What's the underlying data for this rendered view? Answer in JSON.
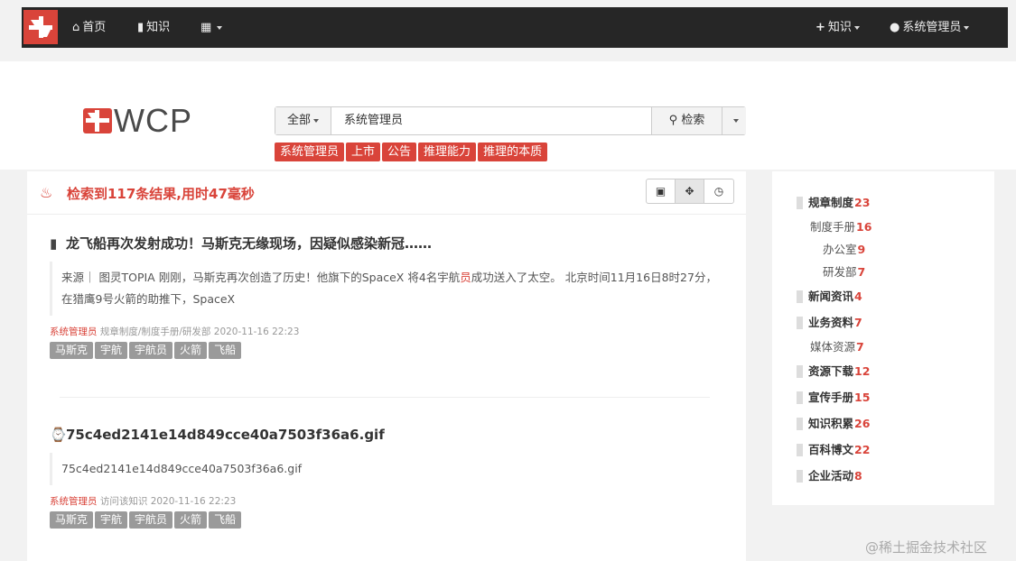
{
  "navbar": {
    "home": "首页",
    "knowledge": "知识",
    "apps": "",
    "new_knowledge": "知识",
    "user": "系统管理员",
    "colors": {
      "background": "#262626",
      "brand": "#d9443a"
    }
  },
  "brand": {
    "wordmark": "WCP"
  },
  "search": {
    "scope": "全部",
    "query": "系统管理员",
    "button": "检索"
  },
  "hot_tags": [
    "系统管理员",
    "上市",
    "公告",
    "推理能力",
    "推理的本质"
  ],
  "results": {
    "summary": "检索到117条结果,用时47毫秒",
    "view_modes": [
      "image-icon",
      "move-icon",
      "clock-icon"
    ],
    "items": [
      {
        "icon": "document-icon",
        "title": "龙飞船再次发射成功！马斯克无缘现场，因疑似感染新冠……",
        "excerpt_before": "来源｜ 图灵TOPIA 刚刚，马斯克再次创造了历史！他旗下的SpaceX 将4名宇航",
        "excerpt_highlight": "员",
        "excerpt_after": "成功送入了太空。 北京时间11月16日8时27分，在猎鹰9号火箭的助推下，SpaceX",
        "author": "系统管理员",
        "path": "规章制度/制度手册/研发部",
        "time": "2020-11-16 22:23",
        "tags": [
          "马斯克",
          "宇航",
          "宇航员",
          "火箭",
          "飞船"
        ]
      },
      {
        "icon": "paperclip-icon",
        "title": "75c4ed2141e14d849cce40a7503f36a6.gif",
        "excerpt_before": "75c4ed2141e14d849cce40a7503f36a6.gif",
        "excerpt_highlight": "",
        "excerpt_after": "",
        "author": "系统管理员",
        "path": "访问该知识",
        "time": "2020-11-16 22:23",
        "tags": [
          "马斯克",
          "宇航",
          "宇航员",
          "火箭",
          "飞船"
        ]
      }
    ]
  },
  "sidebar": {
    "categories": [
      {
        "level": 1,
        "name": "规章制度",
        "count": "23"
      },
      {
        "level": 2,
        "name": "制度手册",
        "count": "16"
      },
      {
        "level": 3,
        "name": "办公室",
        "count": "9"
      },
      {
        "level": 3,
        "name": "研发部",
        "count": "7"
      },
      {
        "level": 1,
        "name": "新闻资讯",
        "count": "4"
      },
      {
        "level": 1,
        "name": "业务资料",
        "count": "7"
      },
      {
        "level": 2,
        "name": "媒体资源",
        "count": "7"
      },
      {
        "level": 1,
        "name": "资源下载",
        "count": "12"
      },
      {
        "level": 1,
        "name": "宣传手册",
        "count": "15"
      },
      {
        "level": 1,
        "name": "知识积累",
        "count": "26"
      },
      {
        "level": 1,
        "name": "百科博文",
        "count": "22"
      },
      {
        "level": 1,
        "name": "企业活动",
        "count": "8"
      }
    ]
  },
  "watermark": "@稀土掘金技术社区"
}
